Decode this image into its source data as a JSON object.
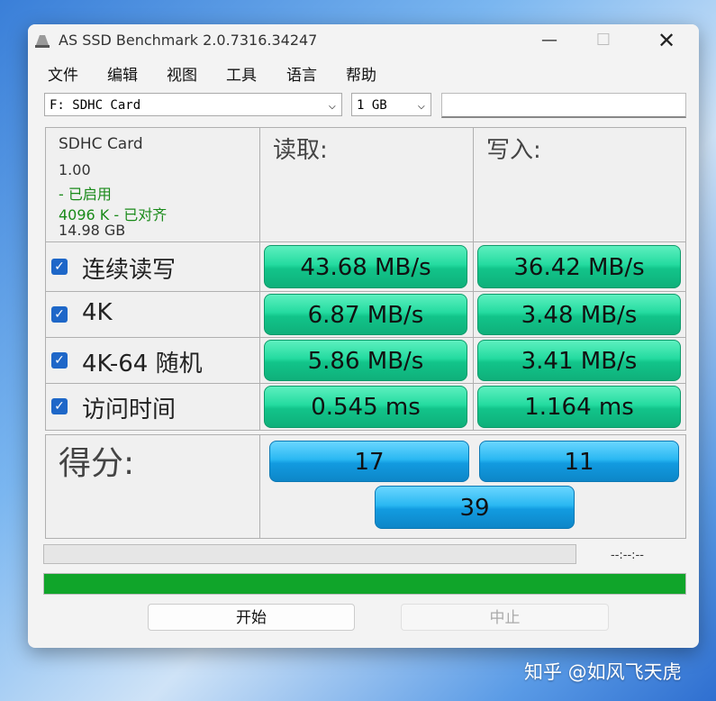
{
  "window": {
    "title": "AS SSD Benchmark 2.0.7316.34247",
    "minimize_glyph": "—",
    "maximize_glyph": "☐",
    "close_glyph": "✕"
  },
  "menu": [
    "文件",
    "编辑",
    "视图",
    "工具",
    "语言",
    "帮助"
  ],
  "drive_select": {
    "value": "F: SDHC Card"
  },
  "size_select": {
    "value": "1 GB"
  },
  "drive_info": {
    "name": "SDHC Card",
    "version": "1.00",
    "status": " - 已启用",
    "alignment": "4096 K - 已对齐",
    "capacity": "14.98 GB"
  },
  "headers": {
    "read": "读取:",
    "write": "写入:"
  },
  "rows": [
    {
      "label": "连续读写",
      "checked": true,
      "read": "43.68 MB/s",
      "write": "36.42 MB/s"
    },
    {
      "label": "4K",
      "checked": true,
      "read": "6.87 MB/s",
      "write": "3.48 MB/s"
    },
    {
      "label": "4K-64 随机",
      "checked": true,
      "read": "5.86 MB/s",
      "write": "3.41 MB/s"
    },
    {
      "label": "访问时间",
      "checked": true,
      "read": "0.545 ms",
      "write": "1.164 ms"
    }
  ],
  "score": {
    "label": "得分:",
    "read": "17",
    "write": "11",
    "total": "39"
  },
  "progress": {
    "time_text": "--:--:--",
    "fill_fraction": 1.0
  },
  "buttons": {
    "start": "开始",
    "stop": "中止"
  },
  "watermark": "知乎 @如风飞天虎",
  "colors": {
    "green_bar": "#10a52a",
    "result_green": "#24dba0",
    "score_blue": "#2ab8f2"
  }
}
